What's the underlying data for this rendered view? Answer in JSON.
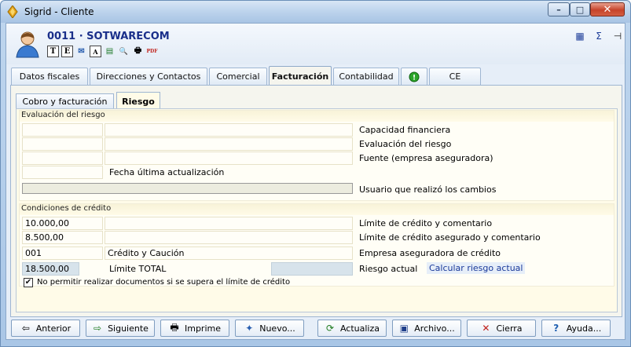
{
  "window": {
    "title": "Sigrid - Cliente",
    "minimize": "–",
    "maximize": "□",
    "close": "✕"
  },
  "header": {
    "client_title": "0011 · SOTWARECOM",
    "tool_icons": [
      "T",
      "E",
      "✉",
      "A",
      "▤",
      "🔍",
      "🖶",
      "PDF"
    ],
    "right_icons": [
      "▦",
      "Σ",
      "⊣"
    ]
  },
  "tabs": [
    {
      "label": "Datos fiscales"
    },
    {
      "label": "Direcciones y Contactos"
    },
    {
      "label": "Comercial"
    },
    {
      "label": "Facturación"
    },
    {
      "label": "Contabilidad"
    },
    {
      "label": ""
    },
    {
      "label": "CE"
    }
  ],
  "subtabs": [
    {
      "label": "Cobro y facturación"
    },
    {
      "label": "Riesgo"
    }
  ],
  "evaluacion": {
    "title": "Evaluación del riesgo",
    "capacidad_label": "Capacidad financiera",
    "evaluacion_label": "Evaluación del riesgo",
    "fuente_label": "Fuente (empresa aseguradora)",
    "fecha_label": "Fecha última actualización",
    "usuario_label": "Usuario que realizó los cambios"
  },
  "credito": {
    "title": "Condiciones de crédito",
    "limite_value": "10.000,00",
    "limite_label": "Límite de crédito y comentario",
    "asegurado_value": "8.500,00",
    "asegurado_label": "Límite de crédito asegurado y comentario",
    "empresa_code": "001",
    "empresa_name": "Crédito y Caución",
    "empresa_label": "Empresa aseguradora de crédito",
    "total_value": "18.500,00",
    "total_label": "Límite TOTAL",
    "riesgo_label": "Riesgo actual",
    "calcular_label": "Calcular riesgo actual",
    "check_label": "No permitir realizar documentos si se supera el límite de crédito",
    "check_mark": "✔"
  },
  "buttons": [
    {
      "label": "Anterior",
      "icon": "⇦"
    },
    {
      "label": "Siguiente",
      "icon": "⇨"
    },
    {
      "label": "Imprime",
      "icon": "🖶"
    },
    {
      "label": "Nuevo...",
      "icon": "✦"
    },
    {
      "label": "Actualiza",
      "icon": "⟳"
    },
    {
      "label": "Archivo...",
      "icon": "▣"
    },
    {
      "label": "Cierra",
      "icon": "✕"
    },
    {
      "label": "Ayuda...",
      "icon": "?"
    }
  ]
}
